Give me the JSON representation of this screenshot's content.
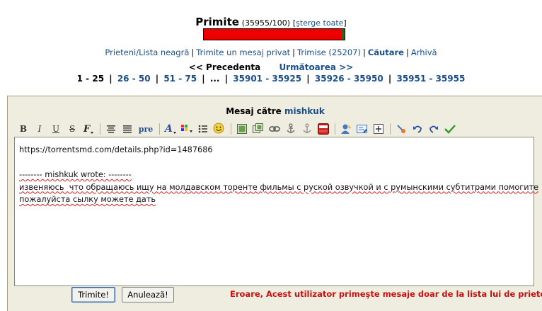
{
  "inbox": {
    "title": "Primite",
    "count": "(35955/100)",
    "bracket_open": "[",
    "delete_all": "şterge toate",
    "bracket_close": "]",
    "progress": 1.0,
    "progress_color": "#ee0000"
  },
  "links": {
    "friends": "Prieteni/Lista neagră",
    "send": "Trimite un mesaj privat",
    "sent": "Trimise (25207)",
    "search": "Căutare",
    "archive": "Arhivă",
    "sep": "|"
  },
  "nav": {
    "prev": "<< Precedenta",
    "next": "Următoarea >>"
  },
  "pages": {
    "current": "1 - 25",
    "items": [
      "26 - 50",
      "51 - 75",
      "...",
      "35901 - 35925",
      "35926 - 35950",
      "35951 - 35955"
    ],
    "sep": "|"
  },
  "compose": {
    "label": "Mesaj către",
    "recipient": "mishkuk",
    "body_lines": [
      "https://torrentsmd.com/details.php?id=1487686",
      "",
      "-------- mishkuk wrote: --------",
      "извеняюсь  что обращаюсь ищу на молдавском торенте фильмы с руской озвучкой и с румынскими субтитрами помогите",
      "пожалуйста сылку можете дать"
    ]
  },
  "toolbar": {
    "bold": "B",
    "italic": "I",
    "underline": "U",
    "strike": "S",
    "font": "F",
    "pre": "pre"
  },
  "buttons": {
    "submit": "Trimite!",
    "cancel": "Anulează!"
  },
  "error": "Eroare, Acest utilizator primeşte mesaje doar de la lista lui de prieteni."
}
